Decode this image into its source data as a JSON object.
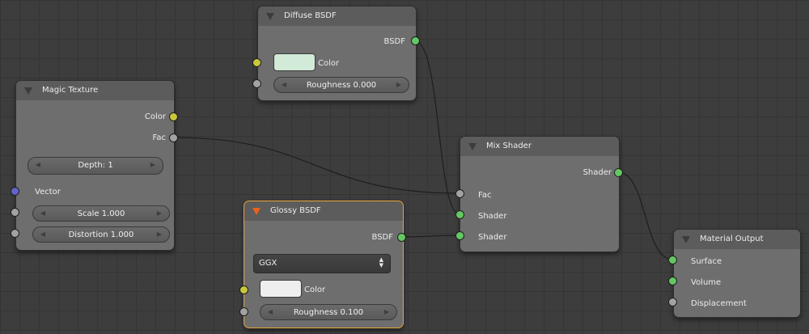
{
  "nodes": {
    "diffuse": {
      "title": "Diffuse BSDF",
      "output": "BSDF",
      "color_label": "Color",
      "color_value": "#d2ead8",
      "roughness": "Roughness 0.000"
    },
    "magic": {
      "title": "Magic Texture",
      "out_color": "Color",
      "out_fac": "Fac",
      "depth": "Depth: 1",
      "vector": "Vector",
      "scale": "Scale 1.000",
      "distortion": "Distortion 1.000"
    },
    "glossy": {
      "title": "Glossy BSDF",
      "output": "BSDF",
      "distribution": "GGX",
      "color_label": "Color",
      "color_value": "#eeeeee",
      "roughness": "Roughness 0.100"
    },
    "mix": {
      "title": "Mix Shader",
      "output": "Shader",
      "in_fac": "Fac",
      "in_shader1": "Shader",
      "in_shader2": "Shader"
    },
    "output": {
      "title": "Material Output",
      "surface": "Surface",
      "volume": "Volume",
      "displacement": "Displacement"
    }
  },
  "colors": {
    "socket_shader": "#63c763",
    "socket_color": "#c8c83c",
    "socket_float": "#a2a2a2",
    "socket_vector": "#6464c8",
    "selected_border": "#e8a33a",
    "selected_triangle": "#e8611e"
  }
}
